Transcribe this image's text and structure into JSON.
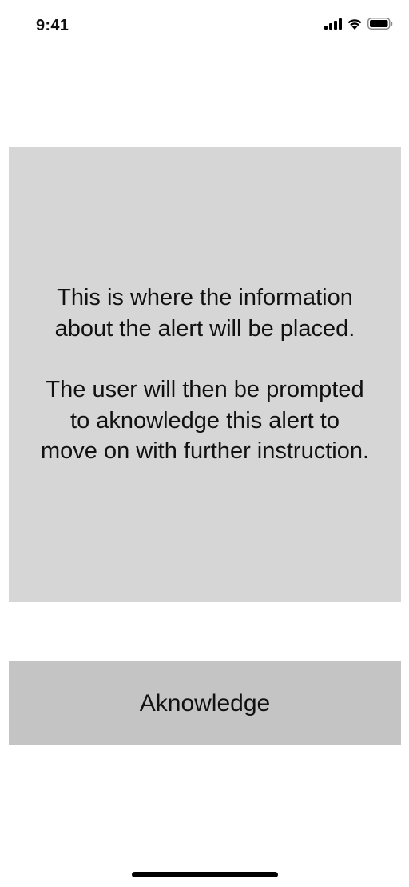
{
  "status_bar": {
    "time": "9:41",
    "icons": [
      "signal-icon",
      "wifi-icon",
      "battery-icon"
    ]
  },
  "alert": {
    "paragraphs": [
      "This is where the information about the alert will be placed.",
      "The user will then be prompted to aknowledge this alert to move on with further instruction."
    ]
  },
  "actions": {
    "acknowledge_label": "Aknowledge"
  },
  "colors": {
    "panel_background": "#d6d6d6",
    "button_background": "#c4c4c4",
    "text": "#111111"
  }
}
